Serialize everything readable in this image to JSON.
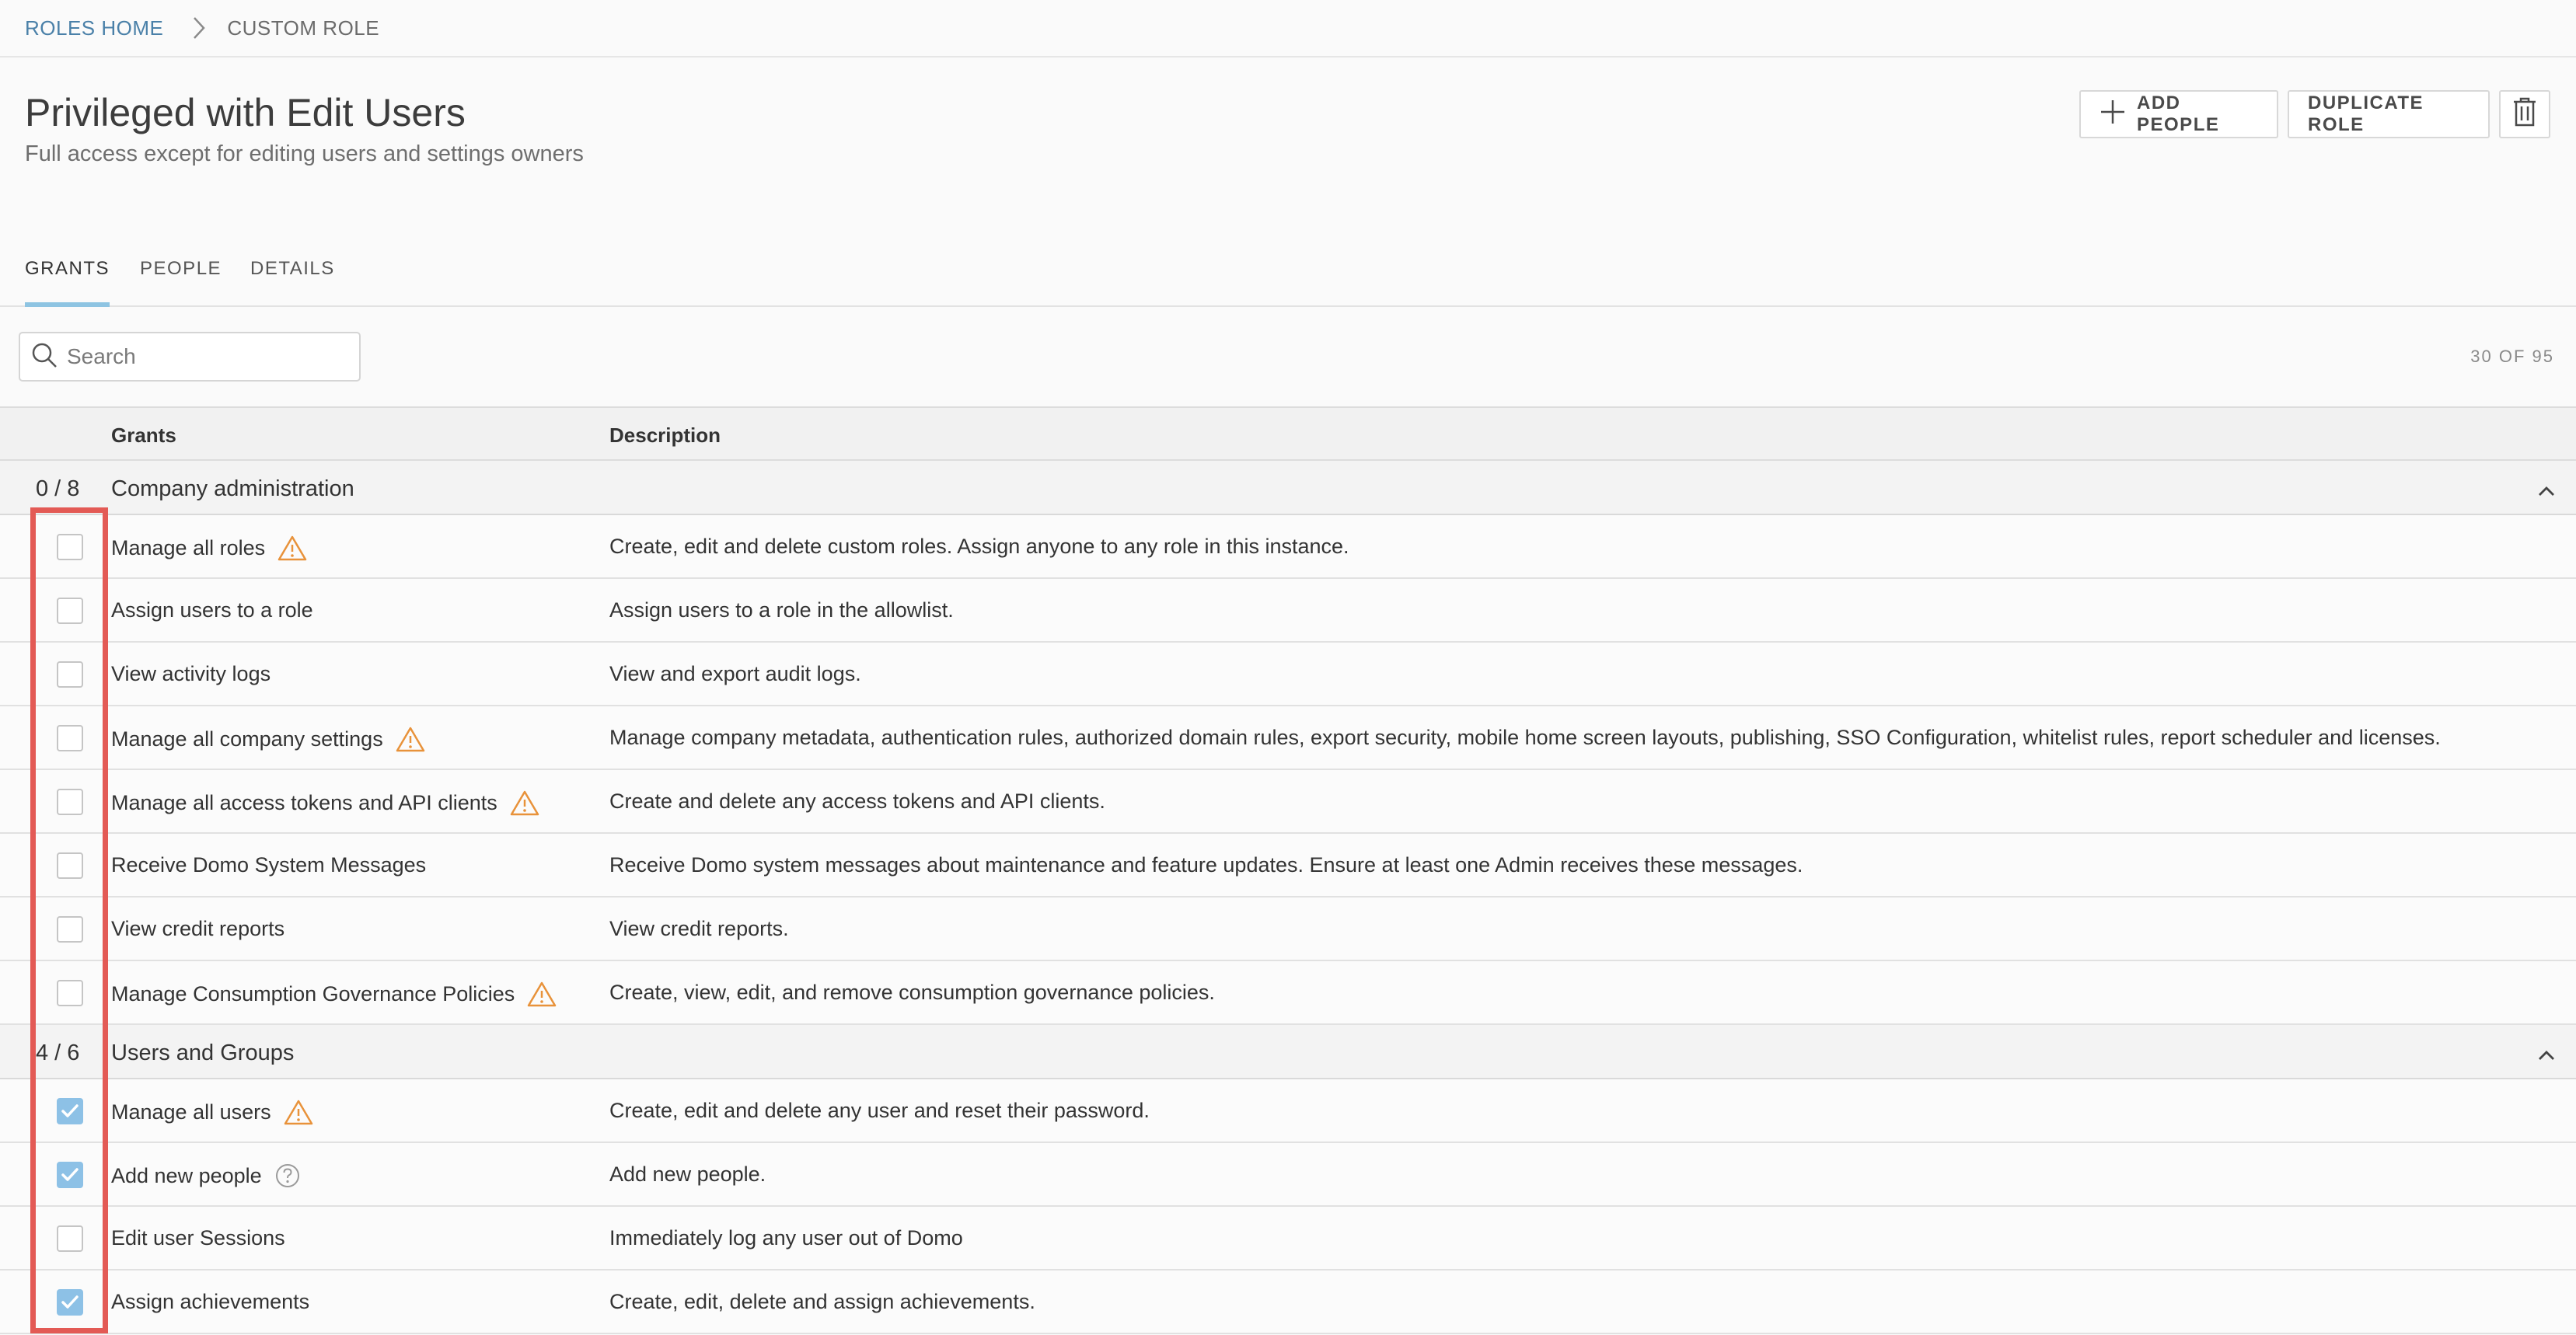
{
  "breadcrumb": {
    "home": "ROLES HOME",
    "current": "CUSTOM ROLE"
  },
  "header": {
    "title": "Privileged with Edit Users",
    "subtitle": "Full access except for editing users and settings owners",
    "add_people": "ADD PEOPLE",
    "duplicate_role": "DUPLICATE ROLE"
  },
  "tabs": [
    {
      "label": "GRANTS",
      "active": true
    },
    {
      "label": "PEOPLE",
      "active": false
    },
    {
      "label": "DETAILS",
      "active": false
    }
  ],
  "search": {
    "placeholder": "Search",
    "value": "",
    "count": "30 OF 95"
  },
  "table": {
    "columns": {
      "grants": "Grants",
      "description": "Description"
    },
    "groups": [
      {
        "count": "0 / 8",
        "name": "Company administration",
        "rows": [
          {
            "grant": "Manage all roles",
            "icon": "warning-icon",
            "checked": false,
            "description": "Create, edit and delete custom roles. Assign anyone to any role in this instance."
          },
          {
            "grant": "Assign users to a role",
            "icon": "",
            "checked": false,
            "description": "Assign users to a role in the allowlist."
          },
          {
            "grant": "View activity logs",
            "icon": "",
            "checked": false,
            "description": "View and export audit logs."
          },
          {
            "grant": "Manage all company settings",
            "icon": "warning-icon",
            "checked": false,
            "description": "Manage company metadata, authentication rules, authorized domain rules, export security, mobile home screen layouts, publishing, SSO Configuration, whitelist rules, report scheduler and licenses."
          },
          {
            "grant": "Manage all access tokens and API clients",
            "icon": "warning-icon",
            "checked": false,
            "description": "Create and delete any access tokens and API clients."
          },
          {
            "grant": "Receive Domo System Messages",
            "icon": "",
            "checked": false,
            "description": "Receive Domo system messages about maintenance and feature updates. Ensure at least one Admin receives these messages."
          },
          {
            "grant": "View credit reports",
            "icon": "",
            "checked": false,
            "description": "View credit reports."
          },
          {
            "grant": "Manage Consumption Governance Policies",
            "icon": "warning-icon",
            "checked": false,
            "description": "Create, view, edit, and remove consumption governance policies."
          }
        ]
      },
      {
        "count": "4 / 6",
        "name": "Users and Groups",
        "rows": [
          {
            "grant": "Manage all users",
            "icon": "warning-icon",
            "checked": true,
            "description": "Create, edit and delete any user and reset their password."
          },
          {
            "grant": "Add new people",
            "icon": "help-icon",
            "checked": true,
            "description": "Add new people."
          },
          {
            "grant": "Edit user Sessions",
            "icon": "",
            "checked": false,
            "description": "Immediately log any user out of Domo"
          },
          {
            "grant": "Assign achievements",
            "icon": "",
            "checked": true,
            "description": "Create, edit, delete and assign achievements."
          }
        ]
      }
    ]
  },
  "colors": {
    "accent": "#8dc1e6",
    "link": "#4a80a8",
    "warning": "#e8923a",
    "annotation": "#e35a55"
  }
}
